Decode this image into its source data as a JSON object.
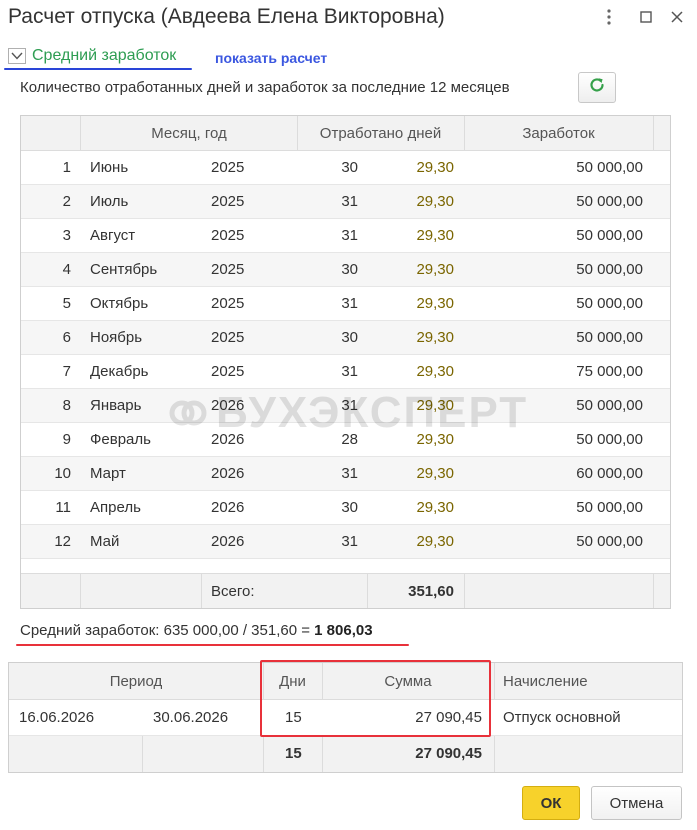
{
  "window": {
    "title": "Расчет отпуска (Авдеева Елена Викторовна)"
  },
  "group": {
    "label": "Средний заработок",
    "show_calc_link": "показать расчет"
  },
  "subtitle": "Количество отработанных дней и заработок за последние 12 месяцев",
  "earnings_table": {
    "headers": {
      "month_year": "Месяц, год",
      "days_worked": "Отработано дней",
      "earnings": "Заработок"
    },
    "rows": [
      {
        "n": "1",
        "month": "Июнь",
        "year": "2025",
        "days": "30",
        "calc_days": "29,30",
        "earnings": "50 000,00"
      },
      {
        "n": "2",
        "month": "Июль",
        "year": "2025",
        "days": "31",
        "calc_days": "29,30",
        "earnings": "50 000,00"
      },
      {
        "n": "3",
        "month": "Август",
        "year": "2025",
        "days": "31",
        "calc_days": "29,30",
        "earnings": "50 000,00"
      },
      {
        "n": "4",
        "month": "Сентябрь",
        "year": "2025",
        "days": "30",
        "calc_days": "29,30",
        "earnings": "50 000,00"
      },
      {
        "n": "5",
        "month": "Октябрь",
        "year": "2025",
        "days": "31",
        "calc_days": "29,30",
        "earnings": "50 000,00"
      },
      {
        "n": "6",
        "month": "Ноябрь",
        "year": "2025",
        "days": "30",
        "calc_days": "29,30",
        "earnings": "50 000,00"
      },
      {
        "n": "7",
        "month": "Декабрь",
        "year": "2025",
        "days": "31",
        "calc_days": "29,30",
        "earnings": "75 000,00"
      },
      {
        "n": "8",
        "month": "Январь",
        "year": "2026",
        "days": "31",
        "calc_days": "29,30",
        "earnings": "50 000,00"
      },
      {
        "n": "9",
        "month": "Февраль",
        "year": "2026",
        "days": "28",
        "calc_days": "29,30",
        "earnings": "50 000,00"
      },
      {
        "n": "10",
        "month": "Март",
        "year": "2026",
        "days": "31",
        "calc_days": "29,30",
        "earnings": "60 000,00"
      },
      {
        "n": "11",
        "month": "Апрель",
        "year": "2026",
        "days": "30",
        "calc_days": "29,30",
        "earnings": "50 000,00"
      },
      {
        "n": "12",
        "month": "Май",
        "year": "2026",
        "days": "31",
        "calc_days": "29,30",
        "earnings": "50 000,00"
      }
    ],
    "footer": {
      "total_label": "Всего:",
      "total_value": "351,60"
    }
  },
  "watermark": "БУХЭКСПЕРТ",
  "average": {
    "prefix": "Средний заработок: 635 000,00 / 351,60 = ",
    "value": "1 806,03"
  },
  "accrual_table": {
    "headers": {
      "period": "Период",
      "days": "Дни",
      "amount": "Сумма",
      "accrual": "Начисление"
    },
    "row": {
      "date_from": "16.06.2026",
      "date_to": "30.06.2026",
      "days": "15",
      "amount": "27 090,45",
      "accrual": "Отпуск основной"
    },
    "footer": {
      "days": "15",
      "amount": "27 090,45"
    }
  },
  "buttons": {
    "ok": "ОК",
    "cancel": "Отмена"
  },
  "colors": {
    "accent_yellow": "#f7d22b",
    "highlight_red": "#e8313a",
    "link_blue": "#3b57e0",
    "group_green": "#2e9d52",
    "calc_days_olive": "#7a6500"
  }
}
